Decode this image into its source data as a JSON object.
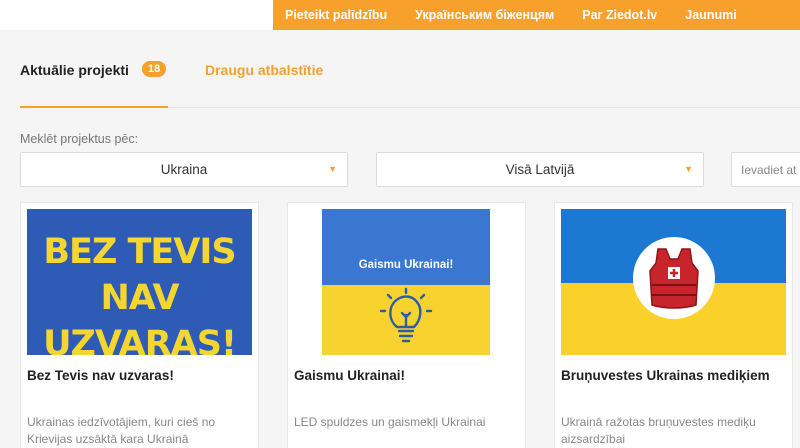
{
  "topnav": {
    "items": [
      "Pieteikt palīdzību",
      "Українським біженцям",
      "Par Ziedot.lv",
      "Jaunumi"
    ]
  },
  "tabs": {
    "active_label": "Aktuālie projekti",
    "active_count": "18",
    "friends_label": "Draugu atbalstītie"
  },
  "search": {
    "label": "Meklēt projektus pēc:",
    "country_value": "Ukraina",
    "region_value": "Visā Latvijā",
    "text_placeholder": "Ievadiet at"
  },
  "cards": [
    {
      "image_text_line1": "BEZ TEVIS",
      "image_text_line2": "NAV UZVARAS!",
      "title": "Bez Tevis nav uzvaras!",
      "description": "Ukrainas iedzīvotājiem, kuri cieš no Krievijas uzsāktā kara Ukrainā"
    },
    {
      "image_text": "Gaismu Ukrainai!",
      "image_icon": "lightbulb-icon",
      "title": "Gaismu Ukrainai!",
      "description": "LED spuldzes un gaismekļi Ukrainai"
    },
    {
      "image_icon": "medic-vest-icon",
      "title": "Bruņuvestes Ukrainas mediķiem",
      "description": "Ukrainā ražotas bruņuvestes mediķu aizsardzībai"
    }
  ],
  "colors": {
    "accent": "#f7a02b",
    "ukraine_blue": "#1d78d2",
    "ukraine_yellow": "#f9d12a"
  }
}
